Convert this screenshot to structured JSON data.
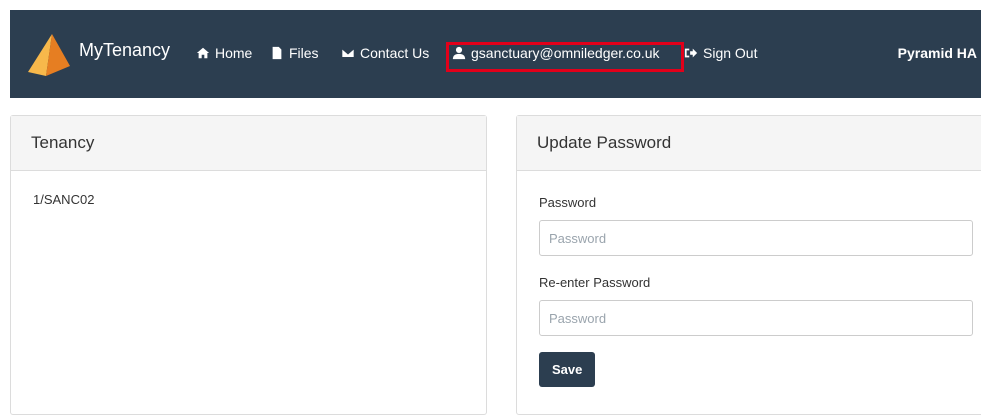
{
  "navbar": {
    "brand": "MyTenancy",
    "links": [
      {
        "label": "Home",
        "icon": "home-icon"
      },
      {
        "label": "Files",
        "icon": "file-icon"
      },
      {
        "label": "Contact Us",
        "icon": "envelope-icon"
      },
      {
        "label": "gsanctuary@omniledger.co.uk",
        "icon": "user-icon"
      },
      {
        "label": "Sign Out",
        "icon": "sign-out-icon"
      }
    ],
    "org": "Pyramid HA",
    "colors": {
      "background": "#2c3e50",
      "highlight": "#e2001a",
      "logo": "#f39c12"
    }
  },
  "tenancy": {
    "title": "Tenancy",
    "reference": "1/SANC02"
  },
  "update_password": {
    "title": "Update Password",
    "password_label": "Password",
    "password_placeholder": "Password",
    "reenter_label": "Re-enter Password",
    "reenter_placeholder": "Password",
    "save_label": "Save"
  }
}
